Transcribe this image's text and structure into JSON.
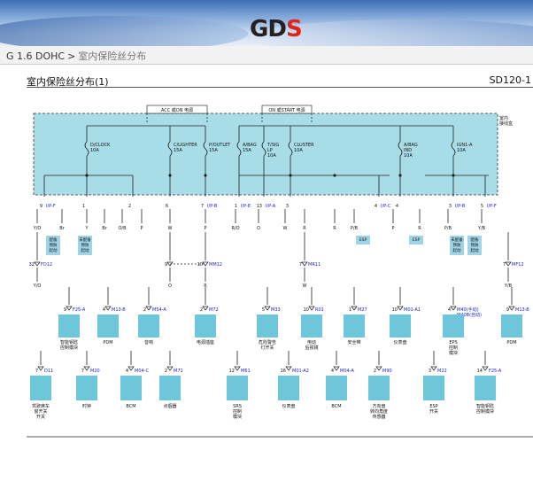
{
  "header": {
    "logo_main": "GD",
    "logo_accent": "S"
  },
  "breadcrumb": {
    "model": "G 1.6 DOHC",
    "separator": ">",
    "page": "室内保险丝分布"
  },
  "document": {
    "title": "室内保险丝分布(1)",
    "code": "SD120-1",
    "junction_label": "室内 接线盒"
  },
  "colors": {
    "fuse_box": "#a8dde8",
    "component": "#6ec6da",
    "note": "#9ed4e6",
    "wire": "#222222",
    "connector_text": "#1a1ad0"
  },
  "feeds": [
    {
      "label": "ACC 或ON 电源"
    },
    {
      "label": "ON 或START 电源"
    }
  ],
  "fuses": [
    {
      "name": "D/CLOCK",
      "rating": "10A"
    },
    {
      "name": "C/LIGHTER",
      "rating": "15A"
    },
    {
      "name": "P/OUTLET",
      "rating": "15A"
    },
    {
      "name": "A/BAG",
      "rating": "15A"
    },
    {
      "name": "T/SIG LP",
      "rating": "10A"
    },
    {
      "name": "CLUSTER",
      "rating": "10A"
    },
    {
      "name": "A/BAG IND",
      "rating": "10A"
    },
    {
      "name": "IGN1-A",
      "rating": "10A"
    }
  ],
  "bottom_pins": [
    {
      "pin": "9",
      "conn": "I/P-F"
    },
    {
      "pin": "1",
      "conn": ""
    },
    {
      "pin": "2",
      "conn": ""
    },
    {
      "pin": "6",
      "conn": ""
    },
    {
      "pin": "7",
      "conn": "I/P-B"
    },
    {
      "pin": "1",
      "conn": "I/P-E"
    },
    {
      "pin": "13",
      "conn": "I/P-A"
    },
    {
      "pin": "3",
      "conn": ""
    },
    {
      "pin": "4",
      "conn": "I/P-C"
    },
    {
      "pin": "4",
      "conn": ""
    },
    {
      "pin": "3",
      "conn": "I/P-B"
    },
    {
      "pin": "5",
      "conn": "I/P-F"
    }
  ],
  "wire_colors": [
    "Y/O",
    "Br",
    "Y",
    "Br",
    "O/B",
    "P",
    "W",
    "P",
    "R/O",
    "O",
    "W",
    "R",
    "R",
    "P/B",
    "P",
    "R",
    "P/B",
    "Y/B"
  ],
  "notes": [
    {
      "text": "配备 预防 起动"
    },
    {
      "text": "未配备 预防 起动"
    },
    {
      "text": "ESP"
    },
    {
      "text": "ESP"
    },
    {
      "text": "未配备 预防 起动"
    },
    {
      "text": "配备 预防 起动"
    }
  ],
  "mid_connectors": [
    {
      "pin": "32",
      "conn": "FD12"
    },
    {
      "pin": "9",
      "conn": ""
    },
    {
      "pin": "10",
      "conn": "MM12"
    },
    {
      "pin": "7",
      "conn": "MR11"
    },
    {
      "pin": "7",
      "conn": "MF12"
    }
  ],
  "mid_wire_colors": [
    "Y/O",
    "O",
    "R",
    "W",
    "Y/B"
  ],
  "row1": [
    {
      "pin": "9",
      "conn": "F25-A",
      "label": "智能钥匙 控制模块"
    },
    {
      "pin": "4",
      "conn": "M13-B",
      "label": "PDM"
    },
    {
      "pin": "2",
      "conn": "M54-A",
      "label": "音响"
    },
    {
      "pin": "2",
      "conn": "M72",
      "label": "电源插座"
    },
    {
      "pin": "5",
      "conn": "M33",
      "label": "危险警告 灯开关"
    },
    {
      "pin": "10",
      "conn": "R01",
      "label": "电动 后视镜"
    },
    {
      "pin": "1",
      "conn": "M27",
      "label": "安全带"
    },
    {
      "pin": "10",
      "conn": "M01-A1",
      "label": "仪表盘"
    },
    {
      "pin": "4",
      "conn": "M40(手动)",
      "conn2": "M40B(自动)",
      "label": "EPS 控制 模块"
    },
    {
      "pin": "9",
      "conn": "M13-B",
      "label": "PDM"
    }
  ],
  "row2": [
    {
      "pin": "7",
      "conn": "D11",
      "label": "驾驶席车 窗开关 开关"
    },
    {
      "pin": "7",
      "conn": "M20",
      "label": "时钟"
    },
    {
      "pin": "4",
      "conn": "M04-C",
      "label": "BCM"
    },
    {
      "pin": "2",
      "conn": "M71",
      "label": "点烟器"
    },
    {
      "pin": "12",
      "conn": "M61",
      "label": "SRS 控制 模块"
    },
    {
      "pin": "16",
      "conn": "M01-A2",
      "label": "仪表盘"
    },
    {
      "pin": "4",
      "conn": "M04-A",
      "label": "BCM"
    },
    {
      "pin": "2",
      "conn": "M90",
      "label": "方向盘 转向角度 传感器"
    },
    {
      "pin": "3",
      "conn": "M22",
      "label": "ESP 开关"
    },
    {
      "pin": "14",
      "conn": "F25-A",
      "label": "智能钥匙 控制模块"
    }
  ]
}
